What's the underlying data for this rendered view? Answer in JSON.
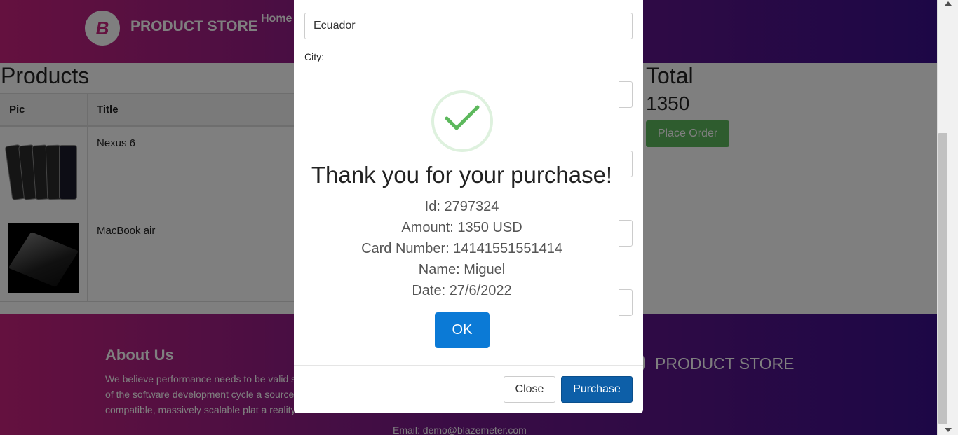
{
  "navbar": {
    "brand_logo_letter": "B",
    "brand_name": "PRODUCT STORE",
    "home_link": "Home"
  },
  "products": {
    "title": "Products",
    "headers": {
      "pic": "Pic",
      "title": "Title"
    },
    "rows": [
      {
        "title": "Nexus 6"
      },
      {
        "title": "MacBook air"
      }
    ]
  },
  "total": {
    "label": "Total",
    "value": "1350",
    "place_order_label": "Place Order"
  },
  "footer": {
    "about_title": "About Us",
    "about_text": "We believe performance needs to be valid stage of the software development cycle a source compatible, massively scalable plat a reality.",
    "email": "Email: demo@blazemeter.com",
    "brand_name": "PRODUCT STORE"
  },
  "order_modal": {
    "country_value": "Ecuador",
    "city_label": "City:",
    "close_label": "Close",
    "purchase_label": "Purchase"
  },
  "alert": {
    "title": "Thank you for your purchase!",
    "id_line": "Id: 2797324",
    "amount_line": "Amount: 1350 USD",
    "card_line": "Card Number: 14141551551414",
    "name_line": "Name: Miguel",
    "date_line": "Date: 27/6/2022",
    "ok_label": "OK",
    "success_color": "#5cb85c"
  }
}
